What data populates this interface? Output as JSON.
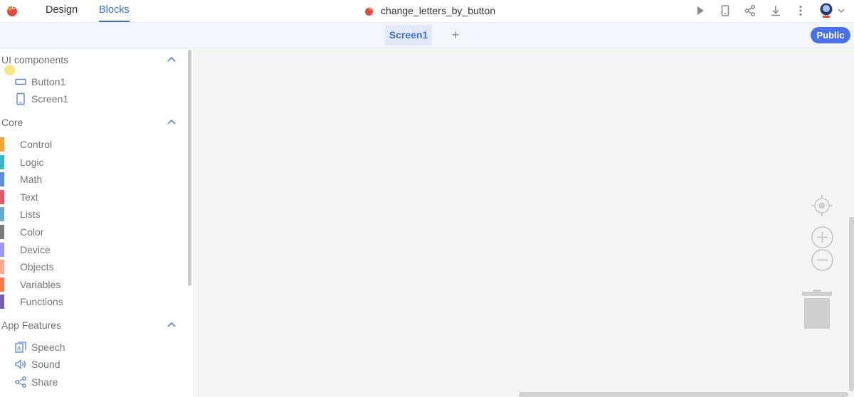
{
  "topbar": {
    "tabs": [
      {
        "label": "Design"
      },
      {
        "label": "Blocks"
      }
    ],
    "project_name": "change_letters_by_button",
    "icons": [
      "play-icon",
      "phone-preview-icon",
      "share-icon",
      "download-icon",
      "more-vert-icon",
      "user-avatar",
      "chevron-down-icon"
    ]
  },
  "screenbar": {
    "current_screen": "Screen1",
    "add_label": "+",
    "public_label": "Public"
  },
  "sidebar": {
    "sections": [
      {
        "title": "UI components"
      },
      {
        "title": "Core"
      },
      {
        "title": "App Features"
      }
    ],
    "ui_components": [
      {
        "label": "Button1",
        "icon": "button-icon"
      },
      {
        "label": "Screen1",
        "icon": "screen-icon"
      }
    ],
    "core": [
      {
        "label": "Control",
        "color": "#f2a440"
      },
      {
        "label": "Logic",
        "color": "#3fb1c0"
      },
      {
        "label": "Math",
        "color": "#5a90d6"
      },
      {
        "label": "Text",
        "color": "#e05a6d"
      },
      {
        "label": "Lists",
        "color": "#6fa8c8"
      },
      {
        "label": "Color",
        "color": "#7a7a7a"
      },
      {
        "label": "Device",
        "color": "#9a9af0"
      },
      {
        "label": "Objects",
        "color": "#f4a890"
      },
      {
        "label": "Variables",
        "color": "#ef7c52"
      },
      {
        "label": "Functions",
        "color": "#7a5fb0"
      }
    ],
    "app_features": [
      {
        "label": "Speech",
        "icon": "speech-icon"
      },
      {
        "label": "Sound",
        "icon": "sound-icon"
      },
      {
        "label": "Share",
        "icon": "share-icon"
      }
    ]
  },
  "workspace": {
    "controls": [
      "recenter-icon",
      "zoom-in-icon",
      "zoom-out-icon",
      "trash-icon"
    ]
  },
  "colors": {
    "accent": "#3d6fe0",
    "public_button": "#4a72e8"
  }
}
